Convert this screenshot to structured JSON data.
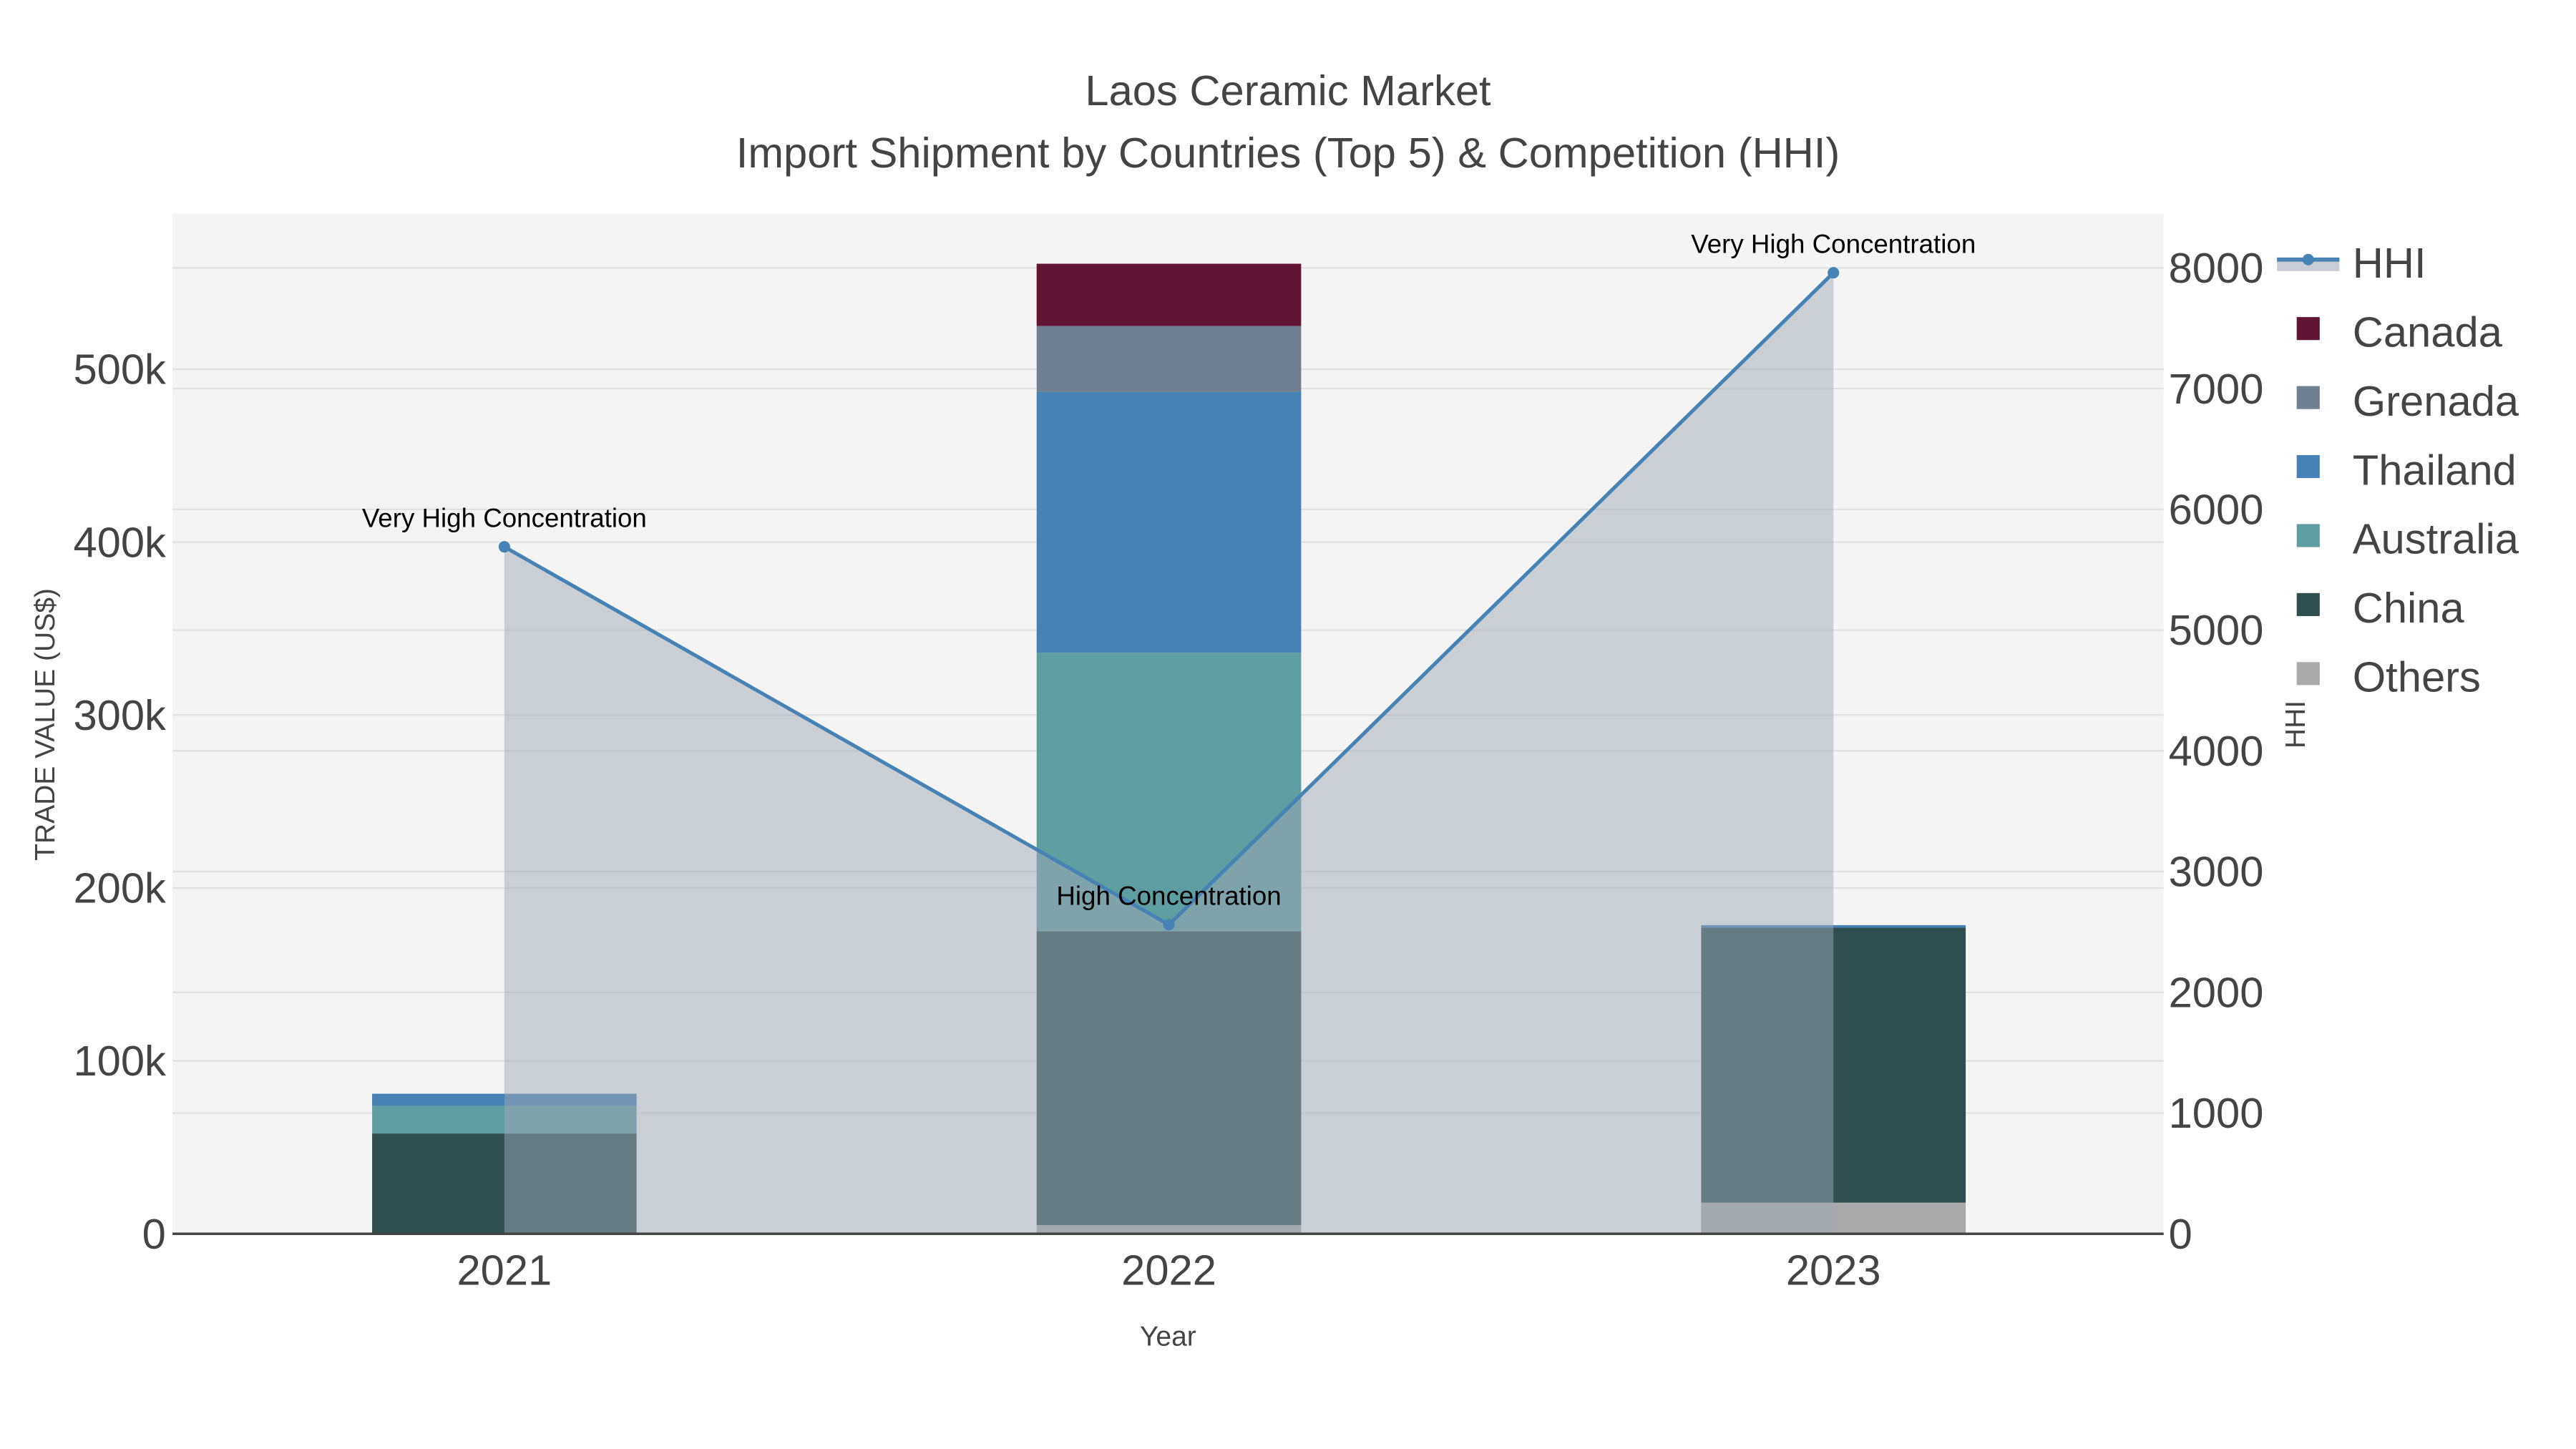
{
  "chart_data": {
    "type": "bar",
    "title": "Laos Ceramic Market",
    "subtitle": "Import Shipment by Countries (Top 5) & Competition (HHI)",
    "xlabel": "Year",
    "ylabel": "TRADE VALUE (US$)",
    "y2label": "HHI",
    "categories": [
      "2021",
      "2022",
      "2023"
    ],
    "ylim": [
      0,
      590000
    ],
    "y2lim": [
      0,
      8450
    ],
    "yticks": [
      0,
      100000,
      200000,
      300000,
      400000,
      500000
    ],
    "ytick_labels": [
      "0",
      "100k",
      "200k",
      "300k",
      "400k",
      "500k"
    ],
    "y2ticks": [
      0,
      1000,
      2000,
      3000,
      4000,
      5000,
      6000,
      7000,
      8000
    ],
    "y2tick_labels": [
      "0",
      "1000",
      "2000",
      "3000",
      "4000",
      "5000",
      "6000",
      "7000",
      "8000"
    ],
    "grid": true,
    "legend_placement": "right",
    "series": [
      {
        "name": "Others",
        "color": "#a9a9a9",
        "values": [
          0,
          5000,
          18000
        ]
      },
      {
        "name": "China",
        "color": "#2f4f4f",
        "values": [
          58000,
          170000,
          159000
        ]
      },
      {
        "name": "Australia",
        "color": "#5f9ea0",
        "values": [
          16000,
          161000,
          0
        ]
      },
      {
        "name": "Thailand",
        "color": "#4682b4",
        "values": [
          7000,
          151000,
          1500
        ]
      },
      {
        "name": "Grenada",
        "color": "#708090",
        "values": [
          0,
          38000,
          0
        ]
      },
      {
        "name": "Canada",
        "color": "#621434",
        "values": [
          0,
          36000,
          0
        ]
      }
    ],
    "hhi": {
      "name": "HHI",
      "color": "#4682b4",
      "values": [
        5690,
        2560,
        7960
      ],
      "annotations": [
        "Very High Concentration",
        "High Concentration",
        "Very High Concentration"
      ]
    },
    "legend_order": [
      "HHI",
      "Canada",
      "Grenada",
      "Thailand",
      "Australia",
      "China",
      "Others"
    ]
  }
}
